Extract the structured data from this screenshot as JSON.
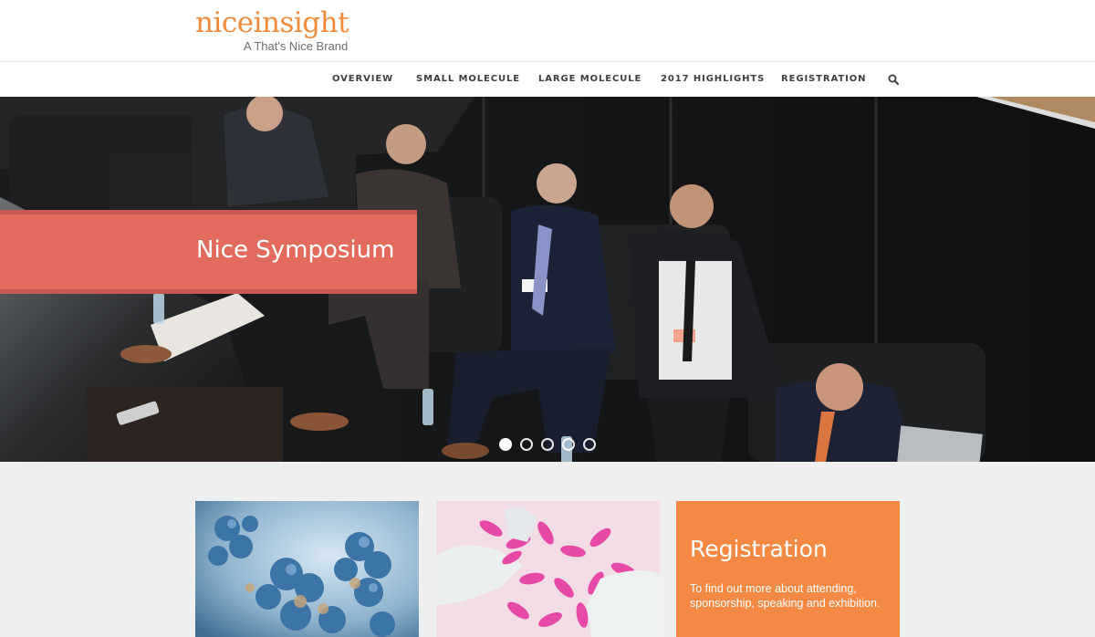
{
  "brand": {
    "logo_text": "niceinsight",
    "tagline": "A That's Nice Brand",
    "accent_color": "#f08b3c"
  },
  "nav": {
    "items": [
      {
        "label": "OVERVIEW"
      },
      {
        "label": "SMALL MOLECULE"
      },
      {
        "label": "LARGE MOLECULE"
      },
      {
        "label": "2017 HIGHLIGHTS"
      },
      {
        "label": "REGISTRATION"
      }
    ],
    "search_icon": "search-icon"
  },
  "hero": {
    "title": "Nice Symposium",
    "banner_color": "#e26b5e",
    "slide_count": 5,
    "active_slide": 1,
    "image": "panel-discussion-photo"
  },
  "cards": [
    {
      "image": "antibody-molecule-illustration"
    },
    {
      "image": "pink-pills-gloved-hands-photo"
    },
    {
      "title": "Registration",
      "description": "To find out more about attending, sponsorship, speaking and exhibition.",
      "color": "#f48943"
    }
  ]
}
